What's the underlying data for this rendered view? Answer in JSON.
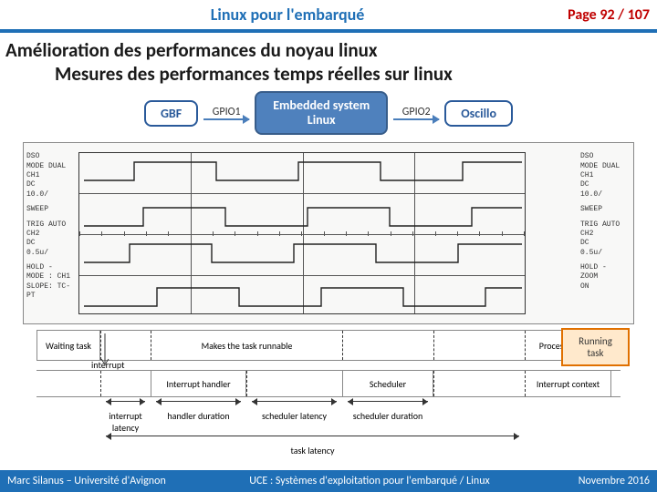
{
  "header": {
    "title": "Linux pour l'embarqué",
    "page_label": "Page 92 / 107"
  },
  "headings": {
    "h1": "Amélioration des performances du noyau linux",
    "h2": "Mesures des performances temps réelles sur linux"
  },
  "flow": {
    "gbf": "GBF",
    "gpio1": "GPIO1",
    "embedded_l1": "Embedded system",
    "embedded_l2": "Linux",
    "gpio2": "GPIO2",
    "oscillo": "Oscillo"
  },
  "scope": {
    "left": {
      "dso": "DSO",
      "mode_dual": "MODE DUAL",
      "ch1": "CH1",
      "dc": "DC",
      "div": "10.0/",
      "sweep": "SWEEP",
      "trig": "TRIG  AUTO",
      "ch2": "CH2",
      "dc2": "DC",
      "div2": "0.5u/",
      "hold": "HOLD   -",
      "mode": "MODE  : CH1",
      "slope": "SLOPE: TC-PT"
    },
    "right": {
      "dso": "DSO",
      "mode_dual": "MODE DUAL",
      "ch1": "CH1",
      "dc": "DC",
      "div": "10.0/",
      "sweep": "SWEEP",
      "trig": "TRIG  AUTO",
      "ch2": "CH2",
      "dc2": "DC",
      "div2": "0.5u/",
      "hold": "HOLD   -",
      "zoom": "ZOOM",
      "on": "ON"
    }
  },
  "timing": {
    "waiting_task": "Waiting task",
    "makes_runnable": "Makes the task runnable",
    "running_task": "Running task",
    "process_context": "Process context",
    "interrupt": "interrupt",
    "interrupt_handler": "Interrupt handler",
    "scheduler": "Scheduler",
    "interrupt_context": "Interrupt context",
    "interrupt_latency": "interrupt latency",
    "handler_duration": "handler duration",
    "scheduler_latency": "scheduler latency",
    "scheduler_duration": "scheduler duration",
    "task_latency": "task latency"
  },
  "footer": {
    "left": "Marc Silanus – Université d'Avignon",
    "mid": "UCE : Systèmes d'exploitation pour l'embarqué / Linux",
    "right": "Novembre 2016"
  }
}
